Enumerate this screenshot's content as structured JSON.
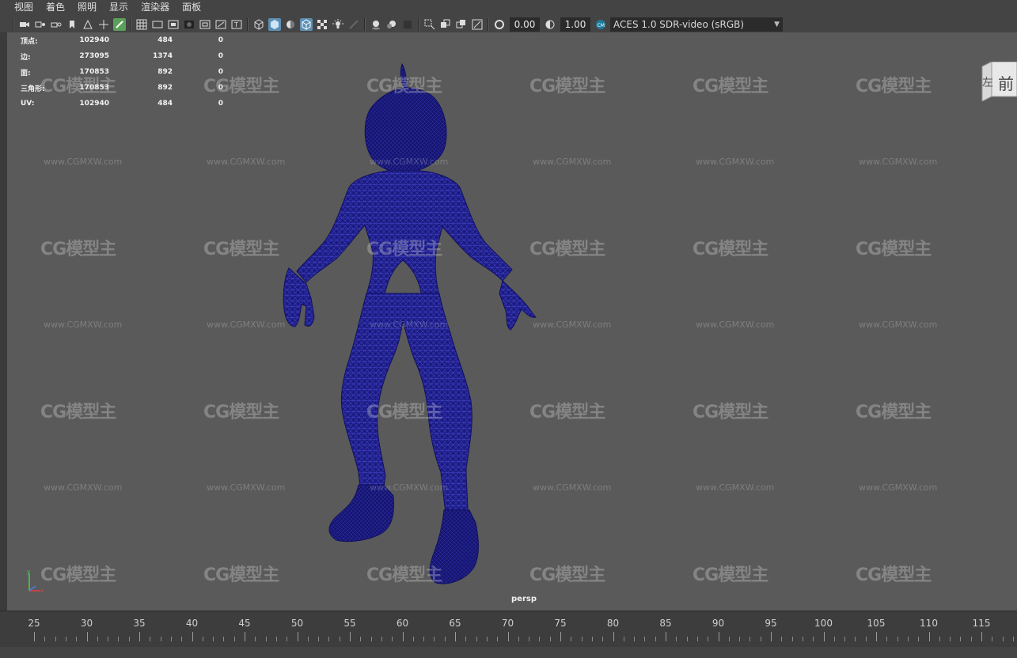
{
  "menus": [
    "视图",
    "着色",
    "照明",
    "显示",
    "渲染器",
    "面板"
  ],
  "toolbar": {
    "exposure_value": "0.00",
    "gamma_value": "1.00",
    "colorspace_label": "ACES 1.0 SDR-video (sRGB)",
    "icons": [
      "camera-select-icon",
      "camera-attributes-icon",
      "bookmark-icon",
      "image-plane-icon",
      "grid-icon",
      "film-gate-icon",
      "resolution-gate-icon",
      "safe-action-icon",
      "wireframe-icon",
      "smooth-shade-icon",
      "textured-icon",
      "lighting-icon",
      "shadows-icon",
      "isolate-select-icon",
      "xray-icon",
      "exposure-icon",
      "gamma-icon",
      "view-transform-icon"
    ]
  },
  "hud": {
    "rows": [
      {
        "label": "顶点:",
        "v1": "102940",
        "v2": "484",
        "v3": "0"
      },
      {
        "label": "边:",
        "v1": "273095",
        "v2": "1374",
        "v3": "0"
      },
      {
        "label": "面:",
        "v1": "170853",
        "v2": "892",
        "v3": "0"
      },
      {
        "label": "三角形:",
        "v1": "170853",
        "v2": "892",
        "v3": "0"
      },
      {
        "label": "UV:",
        "v1": "102940",
        "v2": "484",
        "v3": "0"
      }
    ]
  },
  "viewport": {
    "camera_label": "persp",
    "watermark_logo": "CG模型主",
    "watermark_url": "www.CGMXW.com",
    "wireframe_color": "#1e1e8c",
    "background_color": "#5a5a5a"
  },
  "viewcube": {
    "left_face": "左",
    "front_face": "前"
  },
  "timeslider": {
    "labels": [
      "25",
      "30",
      "35",
      "40",
      "45",
      "50",
      "55",
      "60",
      "65",
      "70",
      "75",
      "80",
      "85",
      "90",
      "95",
      "100",
      "105",
      "110",
      "115"
    ]
  }
}
